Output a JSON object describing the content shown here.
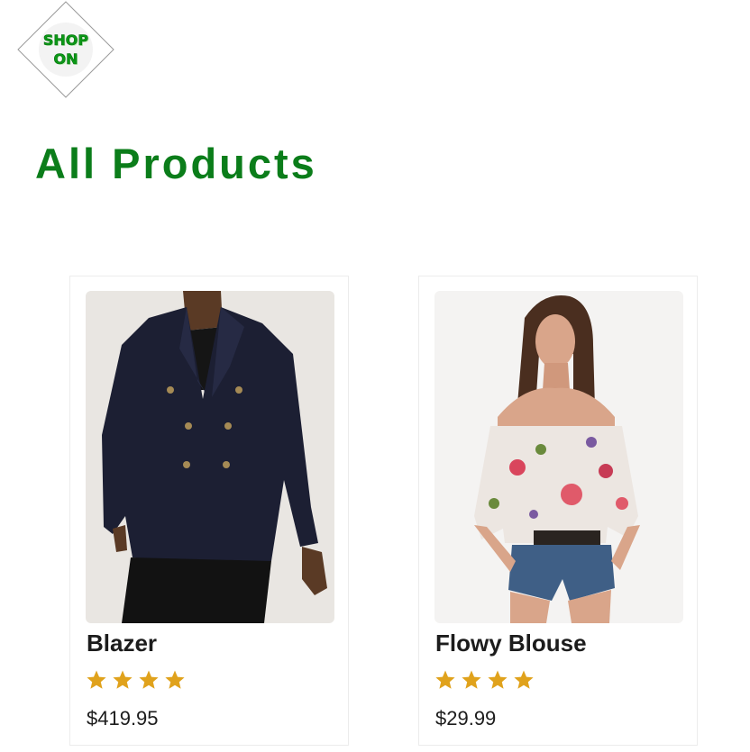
{
  "logo": {
    "line1": "SHOP",
    "line2": "ON",
    "icon": "shop-on-logo"
  },
  "page": {
    "title": "All Products"
  },
  "colors": {
    "brand_green": "#0b7d1a",
    "star_gold": "#e0a21c"
  },
  "products": [
    {
      "name": "Blazer",
      "price": "$419.95",
      "rating": 4,
      "image": "blazer-photo"
    },
    {
      "name": "Flowy Blouse",
      "price": "$29.99",
      "rating": 4,
      "image": "flowy-blouse-photo"
    }
  ]
}
